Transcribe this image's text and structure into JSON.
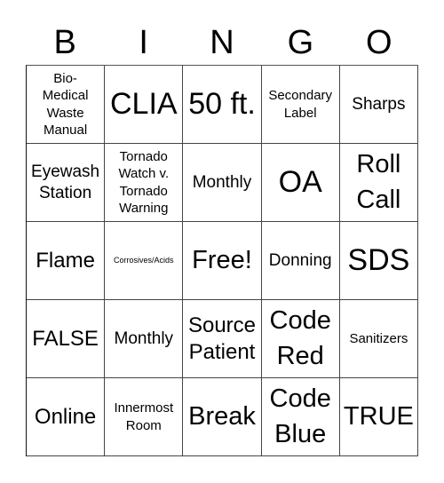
{
  "header": {
    "letters": [
      "B",
      "I",
      "N",
      "G",
      "O"
    ]
  },
  "board": {
    "rows": [
      [
        "Bio-\nMedical\nWaste\nManual",
        "CLIA",
        "50 ft.",
        "Secondary\nLabel",
        "Sharps"
      ],
      [
        "Eyewash\nStation",
        "Tornado\nWatch v.\nTornado\nWarning",
        "Monthly",
        "OA",
        "Roll\nCall"
      ],
      [
        "Flame",
        "Corrosives/Acids",
        "Free!",
        "Donning",
        "SDS"
      ],
      [
        "FALSE",
        "Monthly",
        "Source\nPatient",
        "Code\nRed",
        "Sanitizers"
      ],
      [
        "Online",
        "Innermost\nRoom",
        "Break",
        "Code\nBlue",
        "TRUE"
      ]
    ]
  }
}
